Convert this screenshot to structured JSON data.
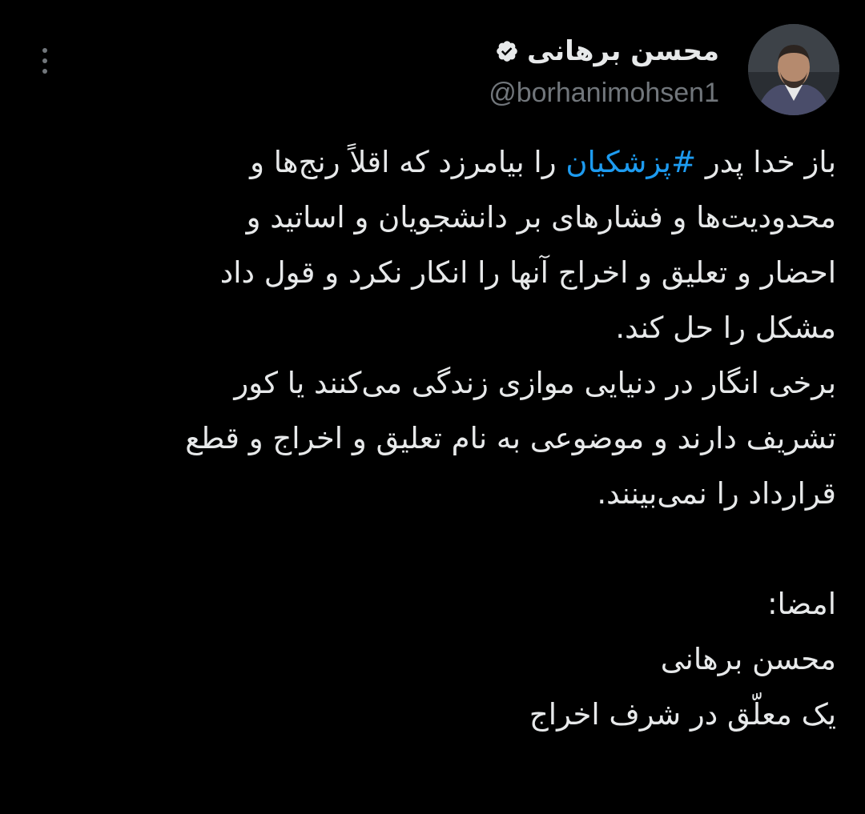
{
  "author": {
    "display_name": "محسن برهانی",
    "handle": "@borhanimohsen1",
    "verified": true
  },
  "tweet": {
    "line1_before": "باز خدا پدر ",
    "hashtag": "#پزشکیان",
    "line1_after": " را بیامرزد که اقلاً رنج‌ها و",
    "paragraph1_rest": "محدودیت‌ها و فشارهای بر دانشجویان و اساتید و\nاحضار و تعلیق و اخراج آنها را انکار نکرد و قول داد\nمشکل را حل کند.",
    "paragraph2": "برخی انگار در دنیایی موازی زندگی می‌کنند یا کور\nتشریف دارند و موضوعی به نام تعلیق و اخراج و قطع\nقرارداد را نمی‌بینند.",
    "signature_label": "امضا:",
    "signature_name": "محسن برهانی",
    "signature_title": "یک معلّق در شرف اخراج"
  },
  "colors": {
    "background": "#000000",
    "text": "#e7e9ea",
    "secondary": "#71767b",
    "accent": "#1d9bf0"
  },
  "icons": {
    "more": "more-vertical-icon",
    "verified": "verified-badge-icon"
  }
}
